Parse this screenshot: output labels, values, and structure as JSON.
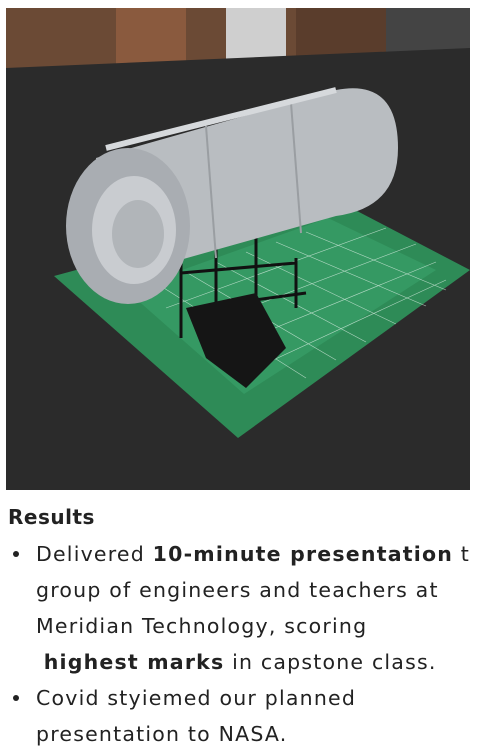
{
  "image": {
    "subject": "3D printed habitat model on cutting mat",
    "colors": {
      "mat": "#2e8b57",
      "cylinder": "#b9bdc1",
      "table": "#2b2b2b",
      "frame": "#111111"
    }
  },
  "results": {
    "heading": "Results",
    "items": [
      {
        "pre": "Delivered ",
        "bold1": "10-minute presentation",
        "mid1": " t",
        "line2": "group of engineers and teachers at",
        "line3": "Meridian Technology, scoring",
        "bold2": "highest marks",
        "post": " in capstone class."
      },
      {
        "line1": "Covid styiemed our planned",
        "line2": "presentation to NASA."
      }
    ]
  }
}
